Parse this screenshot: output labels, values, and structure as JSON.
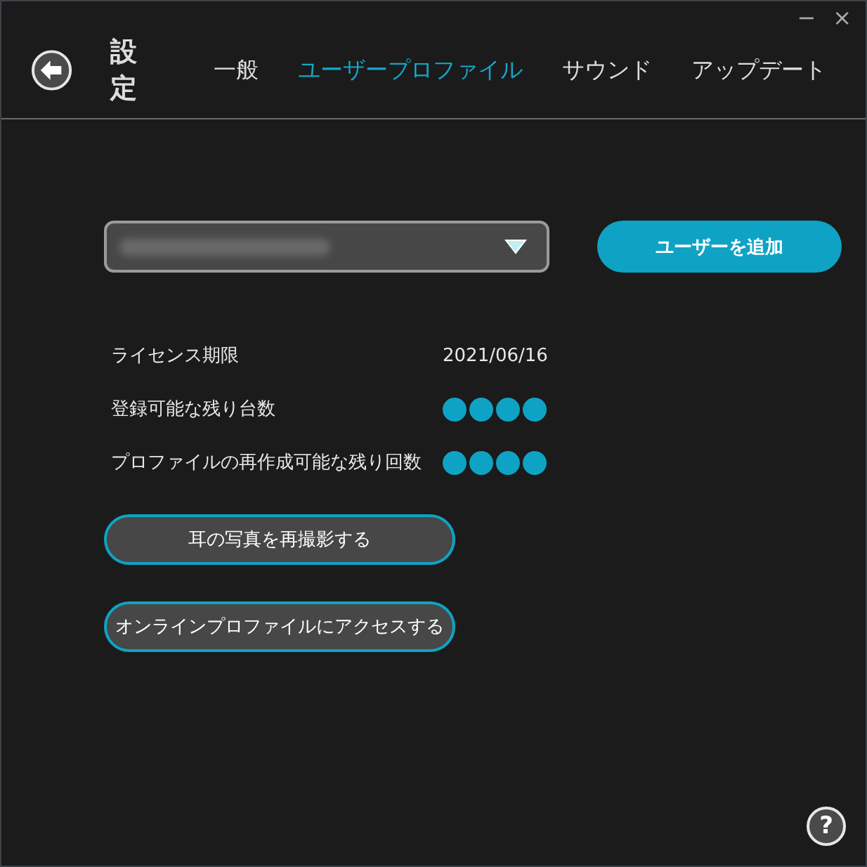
{
  "window_controls": {
    "minimize": "−",
    "close": "×"
  },
  "header": {
    "title": "設定",
    "tabs": [
      {
        "label": "一般",
        "selected": false
      },
      {
        "label": "ユーザープロファイル",
        "selected": true
      },
      {
        "label": "サウンド",
        "selected": false
      },
      {
        "label": "アップデート",
        "selected": false
      }
    ]
  },
  "user_select": {
    "blurred": true
  },
  "add_user_button": "ユーザーを追加",
  "info_rows": [
    {
      "kind": "text",
      "label": "ライセンス期限",
      "value": "2021/06/16"
    },
    {
      "kind": "dots",
      "label": "登録可能な残り台数",
      "stars": 4
    },
    {
      "kind": "dots",
      "label": "プロファイルの再作成可能な残り回数",
      "stars": 4
    }
  ],
  "actions": [
    "耳の写真を再撮影する",
    "オンラインプロファイルにアクセスする"
  ],
  "help": "?"
}
